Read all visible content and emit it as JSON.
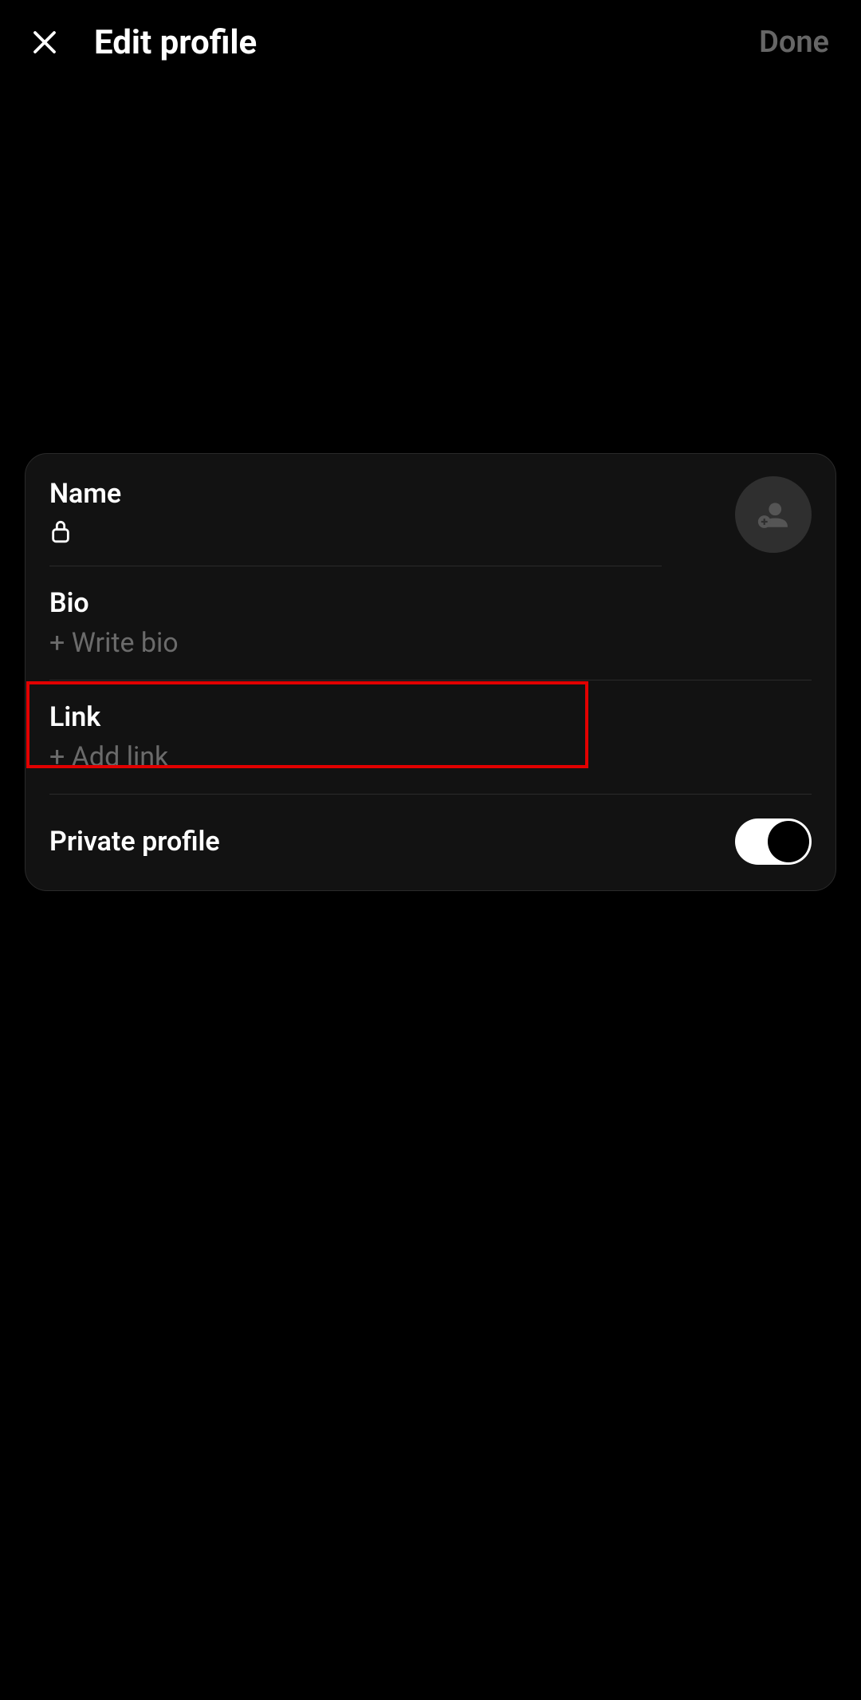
{
  "header": {
    "title": "Edit profile",
    "done_label": "Done"
  },
  "fields": {
    "name": {
      "label": "Name",
      "value": ""
    },
    "bio": {
      "label": "Bio",
      "placeholder": "+ Write bio"
    },
    "link": {
      "label": "Link",
      "placeholder": "+ Add link"
    },
    "private_profile": {
      "label": "Private profile",
      "enabled": true
    }
  }
}
